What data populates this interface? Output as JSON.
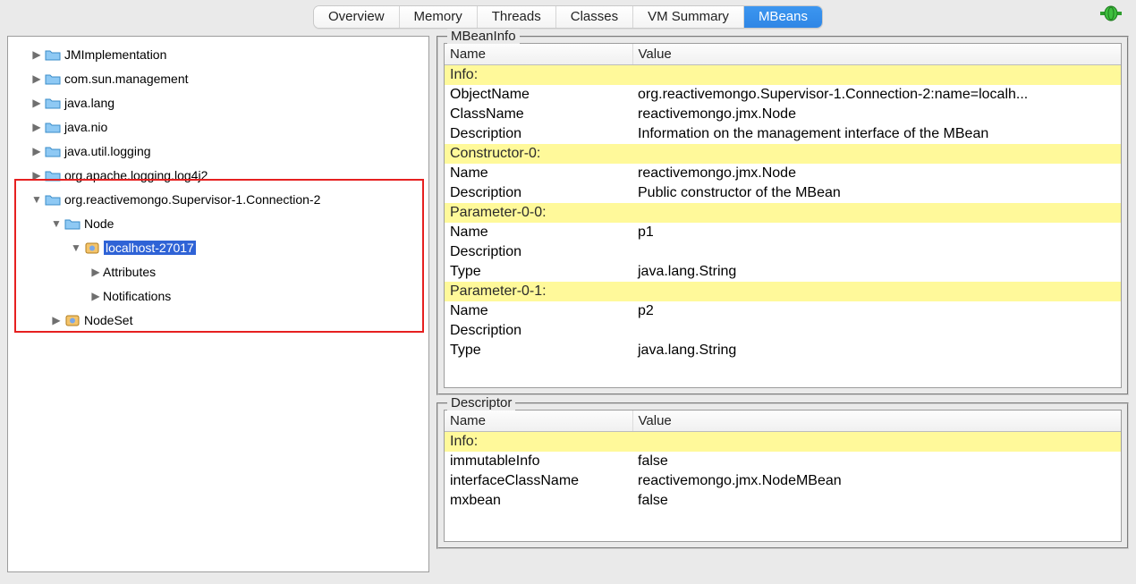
{
  "tabs": [
    "Overview",
    "Memory",
    "Threads",
    "Classes",
    "VM Summary",
    "MBeans"
  ],
  "active_tab": 5,
  "tree": {
    "top": [
      "JMImplementation",
      "com.sun.management",
      "java.lang",
      "java.nio",
      "java.util.logging",
      "org.apache.logging.log4j2"
    ],
    "conn_label": "org.reactivemongo.Supervisor-1.Connection-2",
    "node_label": "Node",
    "host_label": "localhost-27017",
    "attrs_label": "Attributes",
    "notif_label": "Notifications",
    "nodeset_label": "NodeSet"
  },
  "panel1": {
    "legend": "MBeanInfo",
    "headers": {
      "name": "Name",
      "value": "Value"
    },
    "rows": [
      {
        "section": true,
        "name": "Info:",
        "value": ""
      },
      {
        "name": "ObjectName",
        "value": "org.reactivemongo.Supervisor-1.Connection-2:name=localh..."
      },
      {
        "name": "ClassName",
        "value": "reactivemongo.jmx.Node"
      },
      {
        "name": "Description",
        "value": "Information on the management interface of the MBean"
      },
      {
        "section": true,
        "name": "Constructor-0:",
        "value": ""
      },
      {
        "name": "Name",
        "value": "reactivemongo.jmx.Node"
      },
      {
        "name": "Description",
        "value": "Public constructor of the MBean"
      },
      {
        "section": true,
        "name": "Parameter-0-0:",
        "value": ""
      },
      {
        "name": "Name",
        "value": "p1"
      },
      {
        "name": "Description",
        "value": ""
      },
      {
        "name": "Type",
        "value": "java.lang.String"
      },
      {
        "section": true,
        "name": "Parameter-0-1:",
        "value": ""
      },
      {
        "name": "Name",
        "value": "p2"
      },
      {
        "name": "Description",
        "value": ""
      },
      {
        "name": "Type",
        "value": "java.lang.String"
      }
    ]
  },
  "panel2": {
    "legend": "Descriptor",
    "headers": {
      "name": "Name",
      "value": "Value"
    },
    "rows": [
      {
        "section": true,
        "name": "Info:",
        "value": ""
      },
      {
        "name": "immutableInfo",
        "value": "false"
      },
      {
        "name": "interfaceClassName",
        "value": "reactivemongo.jmx.NodeMBean"
      },
      {
        "name": "mxbean",
        "value": "false"
      }
    ]
  }
}
